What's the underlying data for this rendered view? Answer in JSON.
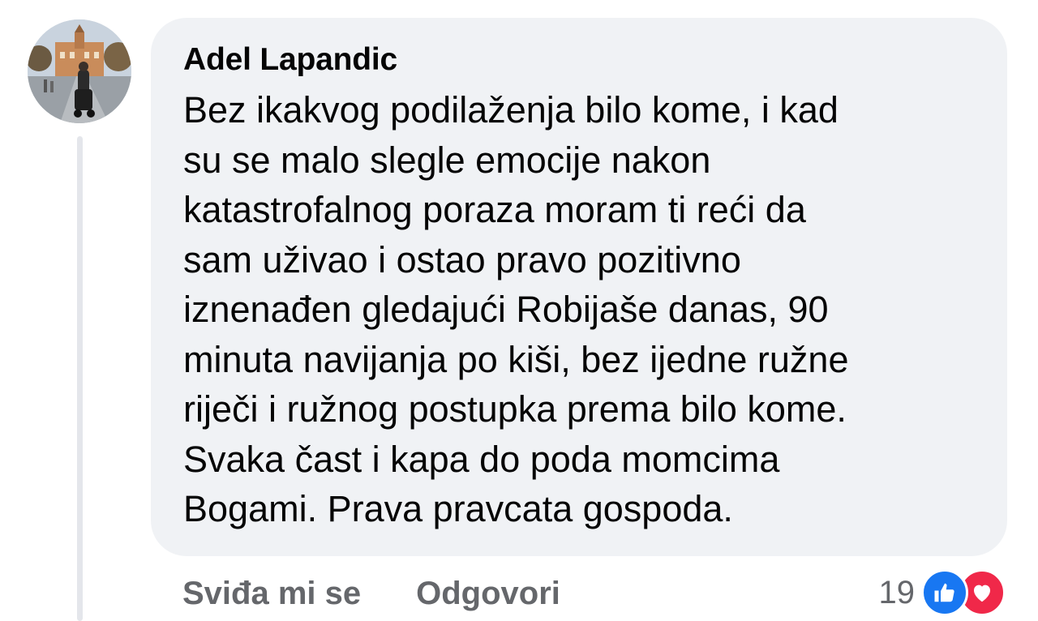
{
  "comment": {
    "author": "Adel Lapandic",
    "text_lines": [
      "Bez ikakvog podilaženja bilo kome, i kad",
      "su se malo slegle emocije nakon",
      "katastrofalnog poraza moram ti reći da",
      "sam uživao i ostao pravo pozitivno",
      "iznenađen gledajući Robijaše danas, 90",
      "minuta navijanja po kiši, bez ijedne ružne",
      "riječi i ružnog postupka prema bilo kome.",
      "Svaka čast i kapa do poda momcima",
      "Bogami. Prava pravcata gospoda."
    ]
  },
  "actions": {
    "like_label": "Sviđa mi se",
    "reply_label": "Odgovori"
  },
  "reactions": {
    "count": "19",
    "icons": [
      "like-icon",
      "love-icon"
    ],
    "colors": {
      "like": "#1877f2",
      "love": "#f02849"
    }
  },
  "colors": {
    "bubble": "#f0f2f5",
    "text": "#050505",
    "secondary_text": "#65676b",
    "thread_line": "#e4e6eb"
  }
}
